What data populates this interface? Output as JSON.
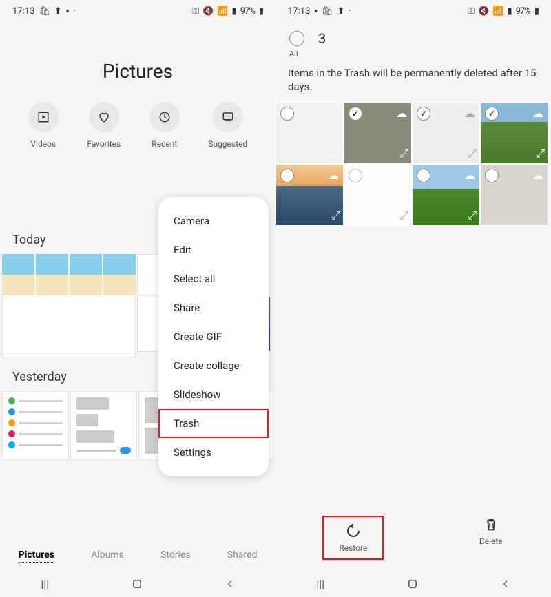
{
  "status": {
    "time": "17:13",
    "battery": "97%"
  },
  "left": {
    "title": "Pictures",
    "categories": [
      {
        "label": "Videos"
      },
      {
        "label": "Favorites"
      },
      {
        "label": "Recent"
      },
      {
        "label": "Suggested"
      }
    ],
    "sections": {
      "today": "Today",
      "yesterday": "Yesterday"
    },
    "tabs": [
      {
        "label": "Pictures",
        "active": true
      },
      {
        "label": "Albums",
        "active": false
      },
      {
        "label": "Stories",
        "active": false
      },
      {
        "label": "Shared",
        "active": false
      }
    ],
    "menu": [
      "Camera",
      "Edit",
      "Select all",
      "Share",
      "Create GIF",
      "Create collage",
      "Slideshow",
      "Trash",
      "Settings"
    ]
  },
  "right": {
    "all_label": "All",
    "selected_count": "3",
    "trash_message": "Items in the Trash will be permanently deleted after 15 days.",
    "actions": {
      "restore": "Restore",
      "delete": "Delete"
    }
  }
}
